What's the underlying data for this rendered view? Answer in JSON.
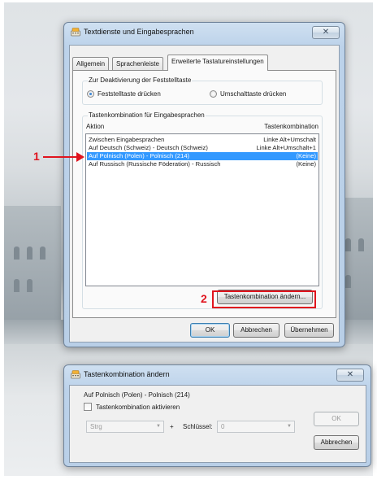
{
  "colors": {
    "accent_red": "#e0141e",
    "selection": "#3399ff"
  },
  "dialog1": {
    "title": "Textdienste und Eingabesprachen",
    "close_glyph": "✕",
    "icon": "keyboard-language-icon",
    "tabs": [
      {
        "label": "Allgemein"
      },
      {
        "label": "Sprachenleiste"
      },
      {
        "label": "Erweiterte Tastatureinstellungen"
      }
    ],
    "capslock_group": {
      "title": "Zur Deaktivierung der Feststelltaste",
      "option1": "Feststelltaste drücken",
      "option2": "Umschalttaste drücken"
    },
    "hotkeys_group": {
      "title": "Tastenkombination für Eingabesprachen",
      "col_action": "Aktion",
      "col_combo": "Tastenkombination",
      "rows": [
        {
          "action": "Zwischen Eingabesprachen",
          "combo": "Linke Alt+Umschalt"
        },
        {
          "action": "Auf Deutsch (Schweiz) - Deutsch (Schweiz)",
          "combo": "Linke Alt+Umschalt+1"
        },
        {
          "action": "Auf Polnisch (Polen) - Polnisch (214)",
          "combo": "(Keine)"
        },
        {
          "action": "Auf Russisch (Russische Föderation) - Russisch",
          "combo": "(Keine)"
        }
      ],
      "change_button": "Tastenkombination ändern..."
    },
    "buttons": {
      "ok": "OK",
      "cancel": "Abbrechen",
      "apply": "Übernehmen"
    }
  },
  "dialog2": {
    "title": "Tastenkombination ändern",
    "close_glyph": "✕",
    "subtitle": "Auf Polnisch (Polen) - Polnisch (214)",
    "checkbox_label": "Tastenkombination aktivieren",
    "modifier_value": "Strg",
    "plus": "+",
    "key_label": "Schlüssel:",
    "key_value": "0",
    "buttons": {
      "ok": "OK",
      "cancel": "Abbrechen"
    }
  },
  "annotations": {
    "callout1": "1",
    "callout2": "2"
  }
}
